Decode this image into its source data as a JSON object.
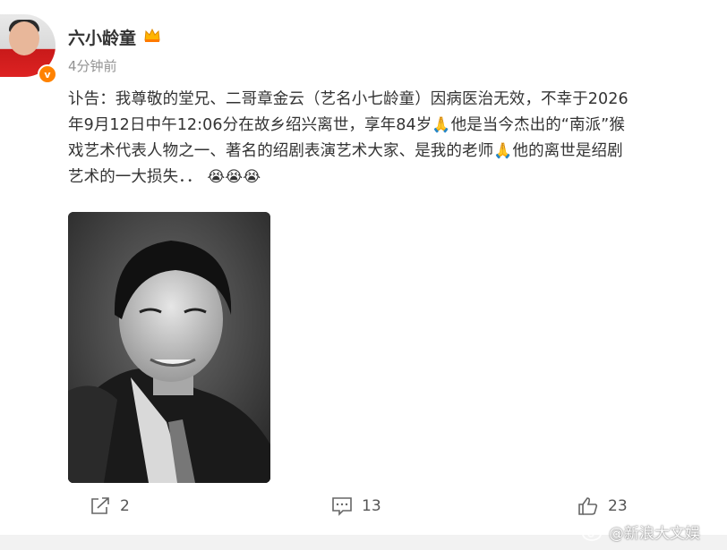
{
  "post": {
    "username": "六小龄童",
    "timestamp": "4分钟前",
    "paragraph_lines": [
      "讣告：我尊敬的堂兄、二哥章金云（艺名小七龄童）因病医治无效，不幸于2026",
      "年9月12日中午12:06分在故乡绍兴离世，享年84岁",
      "他是当今杰出的“南派”猴",
      "戏艺术代表人物之一、著名的绍剧表演艺术大家、是我的老师",
      "他的离世是绍剧",
      "艺术的一大损失．．"
    ],
    "icons": {
      "pray": "pray-emoji-icon",
      "cry": "crying-emoji-icon",
      "crown": "crown-icon",
      "verify": "verified-badge-icon"
    },
    "image": "black-and-white-portrait-photo"
  },
  "actions": {
    "share_count": "2",
    "comment_count": "13",
    "like_count": "23"
  },
  "watermark": {
    "text": "@新浪大文娱"
  },
  "colors": {
    "verify_badge": "#ff8200",
    "text": "#333333",
    "muted": "#939393"
  }
}
